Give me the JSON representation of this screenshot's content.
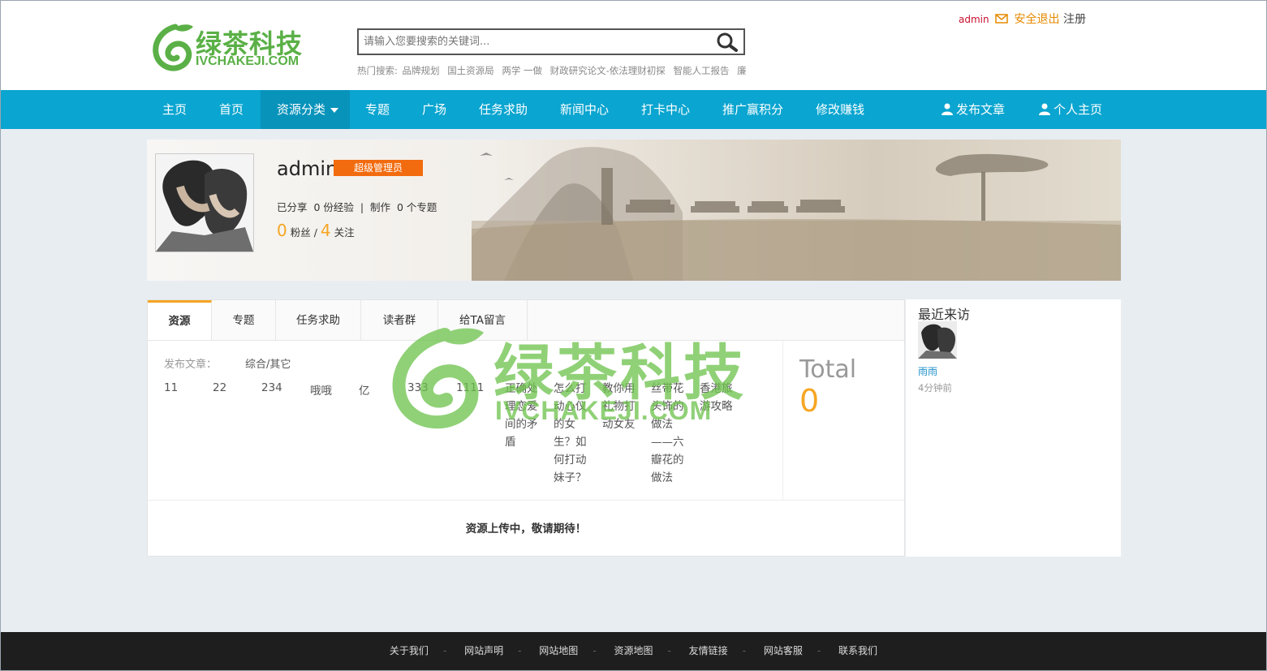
{
  "header": {
    "logo_cn": "绿茶科技",
    "logo_en": "IVCHAKEJI.COM",
    "search_placeholder": "请输入您要搜索的关键词...",
    "hot_label": "热门搜索:",
    "hot_terms": [
      "品牌规划",
      "国土资源局",
      "两学 一做",
      "财政研究论文-依法理财初探",
      "智能人工报告",
      "廉"
    ],
    "username": "admin",
    "logout": "安全退出",
    "register": "注册"
  },
  "nav": {
    "items": [
      "主页",
      "首页",
      "资源分类",
      "专题",
      "广场",
      "任务求助",
      "新闻中心",
      "打卡中心",
      "推广赢积分",
      "修改赚钱"
    ],
    "publish": "发布文章",
    "home": "个人主页"
  },
  "profile": {
    "name": "admin",
    "role": "超级管理员",
    "shared_label": "已分享",
    "exp": "0 份经验",
    "made_label": "制作",
    "topics": "0 个专题",
    "fans": "0",
    "fans_label": "粉丝",
    "follow": "4",
    "follow_label": "关注"
  },
  "tabs": [
    "资源",
    "专题",
    "任务求助",
    "读者群",
    "给TA留言"
  ],
  "content": {
    "pub_label": "发布文章：",
    "pub_cat": "综合/其它",
    "categories": [
      "11",
      "22",
      "234",
      "哦哦",
      "亿",
      "333",
      "1111",
      "正确处理恋爱间的矛盾",
      "怎么打动心仪的女生？如何打动妹子？",
      "教你用礼物打动女友",
      "丝带花头饰的做法——六瓣花的做法",
      "香港旅游攻略"
    ],
    "total_label": "Total",
    "total_value": "0",
    "empty_msg": "资源上传中，敬请期待！"
  },
  "watermark": {
    "cn": "绿茶科技",
    "en": "IVCHAKEJI.COM"
  },
  "sidebar": {
    "title": "最近来访",
    "visitor_name": "雨雨",
    "visitor_time": "4分钟前"
  },
  "footer": [
    "关于我们",
    "网站声明",
    "网站地图",
    "资源地图",
    "友情链接",
    "网站客服",
    "联系我们"
  ],
  "colors": {
    "nav": "#0aa5d0",
    "accent": "#f5a623",
    "badge": "#f26b0f",
    "logo_green": "#5ab046",
    "footer": "#1e1e1e"
  }
}
